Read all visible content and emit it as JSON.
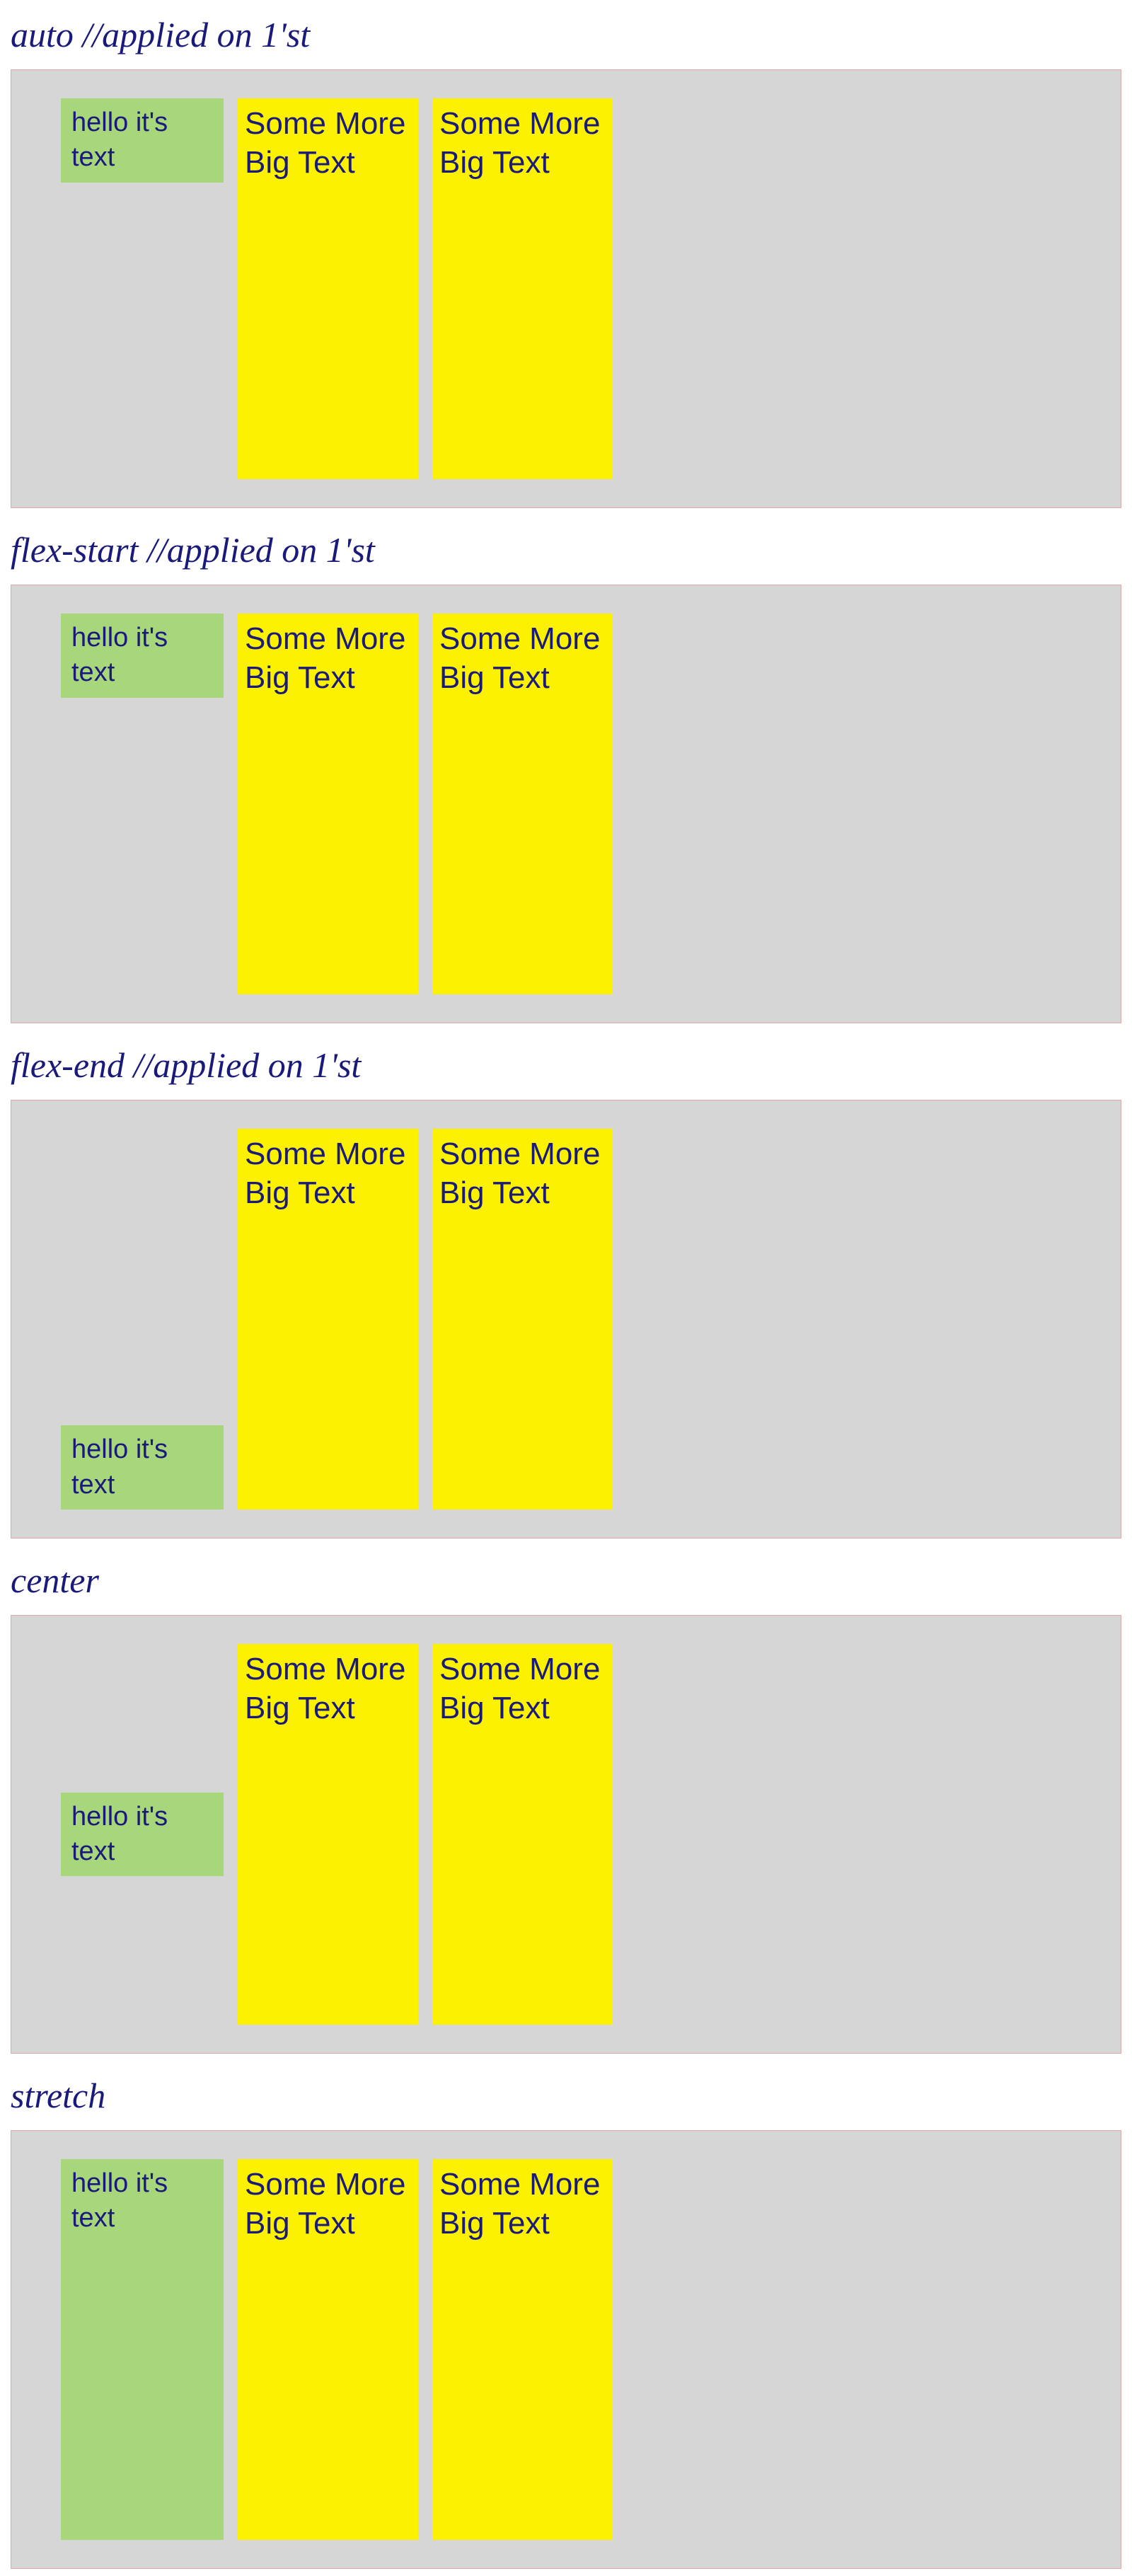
{
  "sections": [
    {
      "title": "auto //applied on 1'st",
      "alignClass": "auto",
      "smallText": "hello it's text",
      "bigText1": "Some More Big Text",
      "bigText2": "Some More Big Text"
    },
    {
      "title": "flex-start  //applied on 1'st",
      "alignClass": "flex-start",
      "smallText": "hello it's text",
      "bigText1": "Some More Big Text",
      "bigText2": "Some More Big Text"
    },
    {
      "title": "flex-end  //applied on 1'st",
      "alignClass": "flex-end",
      "smallText": "hello it's text",
      "bigText1": "Some More Big Text",
      "bigText2": "Some More Big Text"
    },
    {
      "title": "center",
      "alignClass": "center",
      "smallText": "hello it's text",
      "bigText1": "Some More Big Text",
      "bigText2": "Some More Big Text"
    },
    {
      "title": "stretch",
      "alignClass": "stretch",
      "smallText": "hello it's text",
      "bigText1": "Some More Big Text",
      "bigText2": "Some More Big Text"
    }
  ]
}
